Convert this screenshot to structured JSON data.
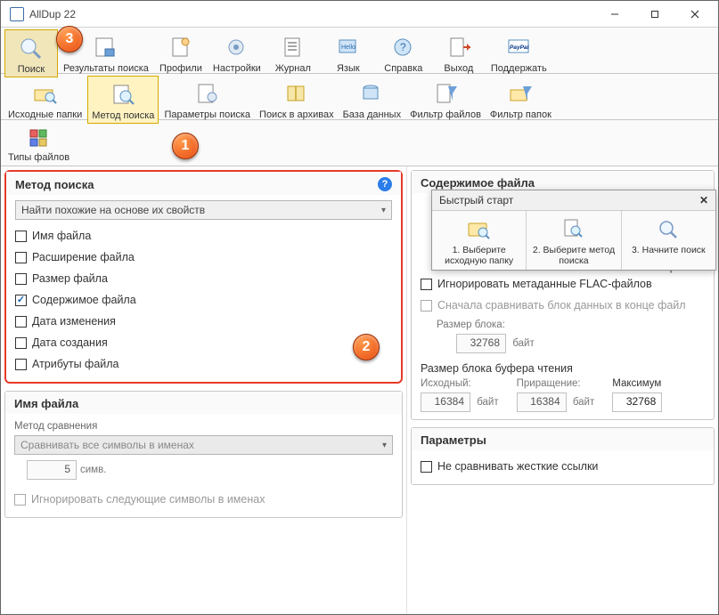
{
  "title": "AllDup  22",
  "ribbon1": [
    {
      "label": "Поиск",
      "icon": "search"
    },
    {
      "label": "Результаты поиска",
      "icon": "results"
    },
    {
      "label": "Профили",
      "icon": "profiles"
    },
    {
      "label": "Настройки",
      "icon": "settings"
    },
    {
      "label": "Журнал",
      "icon": "log"
    },
    {
      "label": "Язык",
      "icon": "lang"
    },
    {
      "label": "Справка",
      "icon": "help"
    },
    {
      "label": "Выход",
      "icon": "exit"
    },
    {
      "label": "Поддержать",
      "icon": "paypal"
    }
  ],
  "ribbon2": [
    {
      "label": "Исходные папки",
      "icon": "src-folders"
    },
    {
      "label": "Метод поиска",
      "icon": "search-method",
      "selected": true
    },
    {
      "label": "Параметры поиска",
      "icon": "search-params"
    },
    {
      "label": "Поиск в архивах",
      "icon": "archives"
    },
    {
      "label": "База данных",
      "icon": "database"
    },
    {
      "label": "Фильтр файлов",
      "icon": "file-filter"
    },
    {
      "label": "Фильтр папок",
      "icon": "folder-filter"
    }
  ],
  "ribbon3": [
    {
      "label": "Типы файлов",
      "icon": "file-types"
    }
  ],
  "method": {
    "title": "Метод поиска",
    "combo": "Найти похожие на основе их свойств",
    "checks": [
      {
        "label": "Имя файла",
        "checked": false
      },
      {
        "label": "Расширение файла",
        "checked": false
      },
      {
        "label": "Размер файла",
        "checked": false
      },
      {
        "label": "Содержимое файла",
        "checked": true
      },
      {
        "label": "Дата изменения",
        "checked": false
      },
      {
        "label": "Дата создания",
        "checked": false
      },
      {
        "label": "Атрибуты файла",
        "checked": false
      }
    ]
  },
  "filename": {
    "title": "Имя файла",
    "sub": "Метод сравнения",
    "combo": "Сравнивать все символы в именах",
    "num": "5",
    "unit": "симв.",
    "ignore": "Игнорировать следующие символы в именах"
  },
  "right": {
    "title": "Содержимое файла",
    "flac": "Игнорировать метаданные FLAC-файлов",
    "flac_tail": "файлах",
    "block_first": "Сначала сравнивать блок данных в конце файл",
    "block_size_label": "Размер блока:",
    "block_size": "32768",
    "unit": "байт",
    "buf_title": "Размер блока буфера чтения",
    "src": "Исходный:",
    "inc": "Приращение:",
    "max": "Максимум",
    "v1": "16384",
    "v2": "16384",
    "v3": "32768",
    "params_title": "Параметры",
    "hardlinks": "Не сравнивать жесткие ссылки"
  },
  "qs": {
    "title": "Быстрый старт",
    "s1": "1. Выберите исходную папку",
    "s2": "2. Выберите метод поиска",
    "s3": "3. Начните поиск"
  }
}
